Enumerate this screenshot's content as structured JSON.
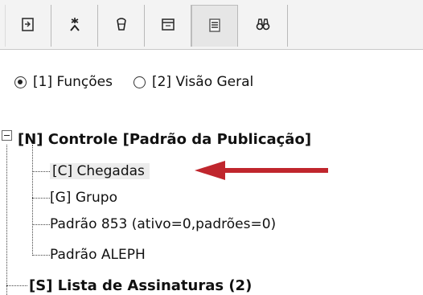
{
  "toolbar": {
    "buttons": [
      {
        "icon": "document-arrow-icon"
      },
      {
        "icon": "asterisk-person-icon"
      },
      {
        "icon": "bag-icon"
      },
      {
        "icon": "window-icon"
      },
      {
        "icon": "list-icon",
        "active": true
      },
      {
        "icon": "binoculars-icon"
      }
    ]
  },
  "view_options": {
    "functions_label": "[1] Funções",
    "overview_label": "[2] Visão Geral",
    "selected": "functions"
  },
  "tree": {
    "root_label": "[N] Controle [Padrão da Publicação]",
    "children": [
      "[C] Chegadas",
      "[G] Grupo",
      "Padrão 853 (ativo=0,padrões=0)",
      "Padrão ALEPH"
    ],
    "next_root_label": "[S] Lista de Assinaturas (2)"
  },
  "colors": {
    "arrow": "#c0262d",
    "toolbar_bg": "#f3f3f3"
  }
}
